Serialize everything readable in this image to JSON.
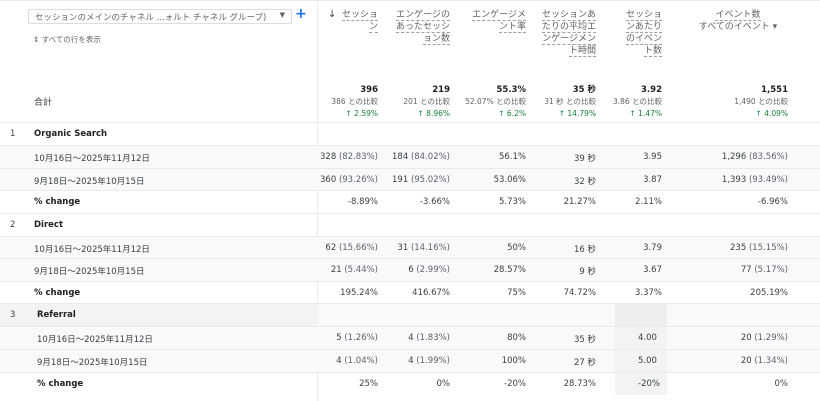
{
  "dimension": {
    "label": "セッションのメインのチャネル ...ォルト チャネル グループ)",
    "add": "+",
    "show_all": "すべての行を表示"
  },
  "columns": [
    {
      "label": "セッション",
      "sorted": true
    },
    {
      "label": "エンゲージのあったセッション数"
    },
    {
      "label": "エンゲージメント率"
    },
    {
      "label": "セッションあたりの平均エンゲージメント時間"
    },
    {
      "label": "セッションあたりのイベント数"
    },
    {
      "label": "イベント数",
      "sub": "すべてのイベント"
    }
  ],
  "totals": {
    "label": "合計",
    "values": [
      {
        "v": "396",
        "c": "386 との比較",
        "d": "↑ 2.59%"
      },
      {
        "v": "219",
        "c": "201 との比較",
        "d": "↑ 8.96%"
      },
      {
        "v": "55.3%",
        "c": "52.07% との比較",
        "d": "↑ 6.2%"
      },
      {
        "v": "35 秒",
        "c": "31 秒 との比較",
        "d": "↑ 14.79%"
      },
      {
        "v": "3.92",
        "c": "3.86 との比較",
        "d": "↑ 1.47%"
      },
      {
        "v": "1,551",
        "c": "1,490 との比較",
        "d": "↑ 4.09%"
      }
    ]
  },
  "groups": [
    {
      "num": "1",
      "name": "Organic Search",
      "rows": [
        {
          "label": "10月16日～2025年11月12日",
          "cells": [
            [
              "328",
              "(82.83%)"
            ],
            [
              "184",
              "(84.02%)"
            ],
            [
              "56.1%"
            ],
            [
              "39 秒"
            ],
            [
              "3.95"
            ],
            [
              "1,296",
              "(83.56%)"
            ]
          ]
        },
        {
          "label": "9月18日～2025年10月15日",
          "cells": [
            [
              "360",
              "(93.26%)"
            ],
            [
              "191",
              "(95.02%)"
            ],
            [
              "53.06%"
            ],
            [
              "32 秒"
            ],
            [
              "3.87"
            ],
            [
              "1,393",
              "(93.49%)"
            ]
          ]
        },
        {
          "label": "% change",
          "cells": [
            [
              "-8.89%"
            ],
            [
              "-3.66%"
            ],
            [
              "5.73%"
            ],
            [
              "21.27%"
            ],
            [
              "2.11%"
            ],
            [
              "-6.96%"
            ]
          ]
        }
      ]
    },
    {
      "num": "2",
      "name": "Direct",
      "rows": [
        {
          "label": "10月16日～2025年11月12日",
          "cells": [
            [
              "62",
              "(15.66%)"
            ],
            [
              "31",
              "(14.16%)"
            ],
            [
              "50%"
            ],
            [
              "16 秒"
            ],
            [
              "3.79"
            ],
            [
              "235",
              "(15.15%)"
            ]
          ]
        },
        {
          "label": "9月18日～2025年10月15日",
          "cells": [
            [
              "21",
              "(5.44%)"
            ],
            [
              "6",
              "(2.99%)"
            ],
            [
              "28.57%"
            ],
            [
              "9 秒"
            ],
            [
              "3.67"
            ],
            [
              "77",
              "(5.17%)"
            ]
          ]
        },
        {
          "label": "% change",
          "cells": [
            [
              "195.24%"
            ],
            [
              "416.67%"
            ],
            [
              "75%"
            ],
            [
              "74.72%"
            ],
            [
              "3.37%"
            ],
            [
              "205.19%"
            ]
          ]
        }
      ]
    },
    {
      "num": "3",
      "name": "Referral",
      "rows": [
        {
          "label": "10月16日～2025年11月12日",
          "cells": [
            [
              "5",
              "(1.26%)"
            ],
            [
              "4",
              "(1.83%)"
            ],
            [
              "80%"
            ],
            [
              "35 秒"
            ],
            [
              "4.00"
            ],
            [
              "20",
              "(1.29%)"
            ]
          ]
        },
        {
          "label": "9月18日～2025年10月15日",
          "cells": [
            [
              "4",
              "(1.04%)"
            ],
            [
              "4",
              "(1.99%)"
            ],
            [
              "100%"
            ],
            [
              "27 秒"
            ],
            [
              "5.00"
            ],
            [
              "20",
              "(1.34%)"
            ]
          ]
        },
        {
          "label": "% change",
          "cells": [
            [
              "25%"
            ],
            [
              "0%"
            ],
            [
              "-20%"
            ],
            [
              "28.73%"
            ],
            [
              "-20%"
            ],
            [
              "0%"
            ]
          ]
        }
      ]
    }
  ],
  "colors": {
    "positive": "#188038",
    "accent": "#1a73e8"
  }
}
